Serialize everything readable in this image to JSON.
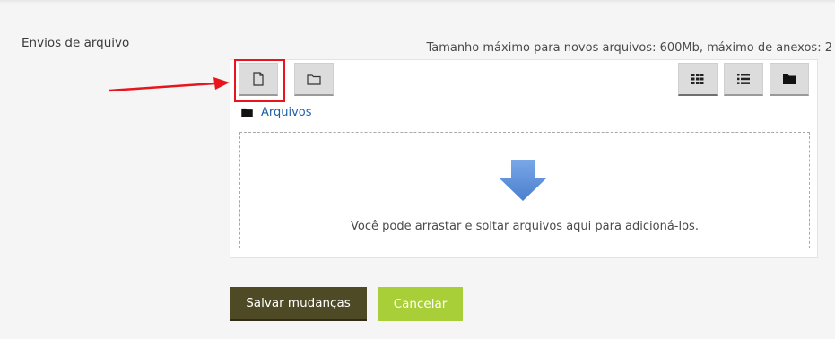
{
  "form": {
    "field_label": "Envios de arquivo",
    "max_info": "Tamanho máximo para novos arquivos: 600Mb, máximo de anexos: 2"
  },
  "filemanager": {
    "toolbar": {
      "add_file_icon": "file-icon",
      "create_folder_icon": "folder-outline-icon",
      "view_icons_icon": "grid-icon",
      "view_list_icon": "list-icon",
      "view_tree_icon": "folder-solid-icon"
    },
    "path": {
      "folder_icon": "folder-solid-icon",
      "label": "Arquivos"
    },
    "dropzone": {
      "icon": "down-arrow-icon",
      "text": "Você pode arrastar e soltar arquivos aqui para adicioná-los."
    }
  },
  "buttons": {
    "save": "Salvar mudanças",
    "cancel": "Cancelar"
  },
  "colors": {
    "highlight": "#e8151d",
    "save_bg": "#4f4a26",
    "cancel_bg": "#a8cf38",
    "link": "#1f5fa8",
    "drop_arrow": "#5b8ed6"
  }
}
